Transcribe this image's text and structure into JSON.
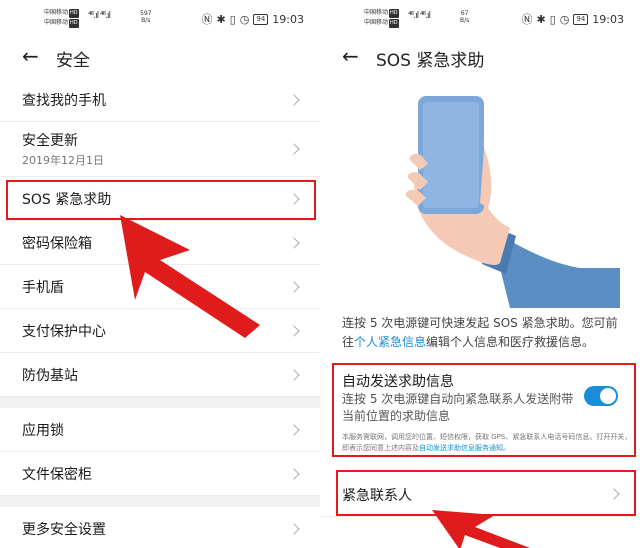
{
  "left": {
    "status": {
      "carrier1": "中国移动",
      "carrier2": "中国移动",
      "tag": "HD",
      "signal": "⁴⁶.ıl ⁴⁶.ıl",
      "speed_val": "597",
      "speed_unit": "B/s",
      "battery": "94",
      "time": "19:03"
    },
    "header": {
      "back_icon": "arrow-left-icon",
      "title": "安全"
    },
    "items": [
      {
        "label": "查找我的手机"
      },
      {
        "label": "安全更新",
        "sub": "2019年12月1日"
      },
      {
        "label": "SOS 紧急求助"
      },
      {
        "label": "密码保险箱"
      },
      {
        "label": "手机盾"
      },
      {
        "label": "支付保护中心"
      },
      {
        "label": "防伪基站"
      },
      {
        "label": "应用锁"
      },
      {
        "label": "文件保密柜"
      },
      {
        "label": "更多安全设置"
      }
    ]
  },
  "right": {
    "status": {
      "carrier1": "中国移动",
      "carrier2": "中国移动",
      "tag": "HD",
      "signal": "⁴⁶.ıl ⁴⁶.ıl",
      "speed_val": "67",
      "speed_unit": "B/s",
      "battery": "94",
      "time": "19:03"
    },
    "header": {
      "back_icon": "arrow-left-icon",
      "title": "SOS 紧急求助"
    },
    "description_pre": "连按 5 次电源键可快速发起 SOS 紧急求助。您可前往",
    "description_link": "个人紧急信息",
    "description_post": "编辑个人信息和医疗救援信息。",
    "auto_send": {
      "title": "自动发送求助信息",
      "desc": "连按 5 次电源键自动向紧急联系人发送附带当前位置的求助信息",
      "enabled": true,
      "fine_pre": "本服务需联网，调用您的位置、短信权限，获取 GPS、紧急联系人电话号码信息。打开开关，即表示您同意上述内容及",
      "fine_link": "自动发送求助信息服务通知。"
    },
    "emergency_contacts": {
      "label": "紧急联系人"
    }
  },
  "colors": {
    "accent": "#1a8cd8",
    "highlight": "#e01b1b",
    "phone": "#7ba7d9",
    "sleeve": "#5b8fc4"
  }
}
